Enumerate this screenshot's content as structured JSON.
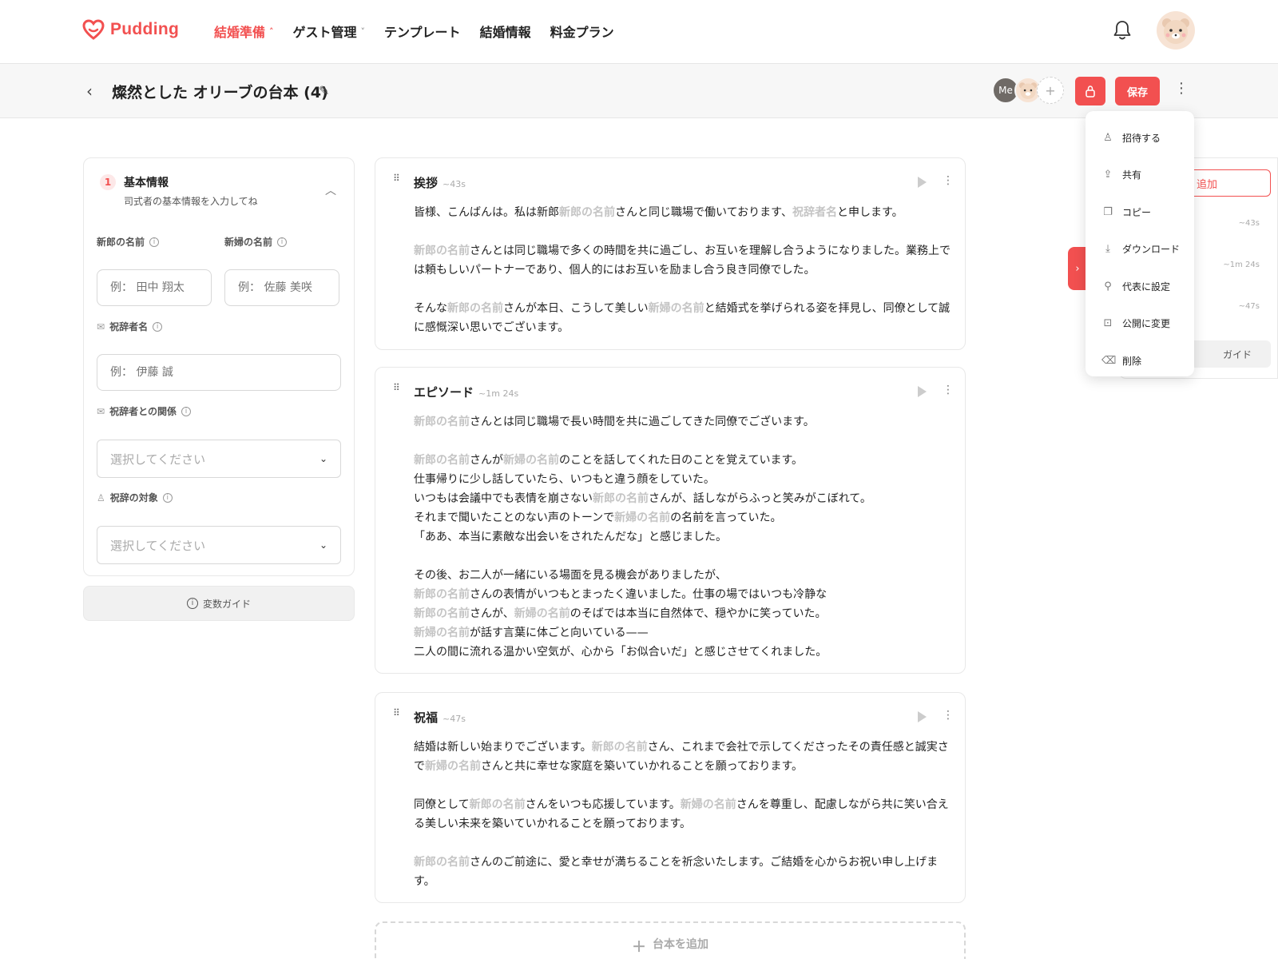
{
  "brand": {
    "name": "Pudding",
    "color": "#f25050"
  },
  "nav": {
    "items": [
      {
        "label": "結婚準備",
        "active": true,
        "chevron": "˄"
      },
      {
        "label": "ゲスト管理",
        "active": false,
        "chevron": "˅"
      },
      {
        "label": "テンプレート",
        "active": false,
        "chevron": ""
      },
      {
        "label": "結婚情報",
        "active": false,
        "chevron": ""
      },
      {
        "label": "料金プラン",
        "active": false,
        "chevron": ""
      }
    ]
  },
  "subheader": {
    "title": "燦然とした オリーブの台本 (4)",
    "collaborator_me": "Me",
    "save_label": "保存"
  },
  "basic_info": {
    "step": "1",
    "title": "基本情報",
    "subtitle": "司式者の基本情報を入力してね",
    "groom_label": "新郎の名前",
    "groom_placeholder": "例： 田中 翔太",
    "bride_label": "新婦の名前",
    "bride_placeholder": "例： 佐藤 美咲",
    "speaker_label": "祝辞者名",
    "speaker_placeholder": "例： 伊藤 誠",
    "relation_label": "祝辞者との関係",
    "relation_value": "選択してください",
    "target_label": "祝辞の対象",
    "target_value": "選択してください",
    "guide_label": "変数ガイド"
  },
  "scripts": [
    {
      "title": "挨拶",
      "duration": "~43s",
      "paragraphs": [
        [
          [
            "t",
            "皆様、こんばんは。私は新郎"
          ],
          [
            "v",
            "新郎の名前"
          ],
          [
            "t",
            "さんと同じ職場で働いております、"
          ],
          [
            "v",
            "祝辞者名"
          ],
          [
            "t",
            "と申します。"
          ]
        ],
        [
          [
            "v",
            "新郎の名前"
          ],
          [
            "t",
            "さんとは同じ職場で多くの時間を共に過ごし、お互いを理解し合うようになりました。業務上では頼もしいパートナーであり、個人的にはお互いを励まし合う良き同僚でした。"
          ]
        ],
        [
          [
            "t",
            "そんな"
          ],
          [
            "v",
            "新郎の名前"
          ],
          [
            "t",
            "さんが本日、こうして美しい"
          ],
          [
            "v",
            "新婦の名前"
          ],
          [
            "t",
            "と結婚式を挙げられる姿を拝見し、同僚として誠に感慨深い思いでございます。"
          ]
        ]
      ]
    },
    {
      "title": "エピソード",
      "duration": "~1m 24s",
      "paragraphs": [
        [
          [
            "v",
            "新郎の名前"
          ],
          [
            "t",
            "さんとは同じ職場で長い時間を共に過ごしてきた同僚でございます。"
          ]
        ],
        [
          [
            "v",
            "新郎の名前"
          ],
          [
            "t",
            "さんが"
          ],
          [
            "v",
            "新婦の名前"
          ],
          [
            "t",
            "のことを話してくれた日のことを覚えています。"
          ],
          [
            "br",
            ""
          ],
          [
            "t",
            "仕事帰りに少し話していたら、いつもと違う顔をしていた。"
          ],
          [
            "br",
            ""
          ],
          [
            "t",
            "いつもは会議中でも表情を崩さない"
          ],
          [
            "v",
            "新郎の名前"
          ],
          [
            "t",
            "さんが、話しながらふっと笑みがこぼれて。"
          ],
          [
            "br",
            ""
          ],
          [
            "t",
            "それまで聞いたことのない声のトーンで"
          ],
          [
            "v",
            "新婦の名前"
          ],
          [
            "t",
            "の名前を言っていた。"
          ],
          [
            "br",
            ""
          ],
          [
            "t",
            "「ああ、本当に素敵な出会いをされたんだな」と感じました。"
          ]
        ],
        [
          [
            "t",
            "その後、お二人が一緒にいる場面を見る機会がありましたが、"
          ],
          [
            "br",
            ""
          ],
          [
            "v",
            "新郎の名前"
          ],
          [
            "t",
            "さんの表情がいつもとまったく違いました。仕事の場ではいつも冷静な"
          ],
          [
            "br",
            ""
          ],
          [
            "v",
            "新郎の名前"
          ],
          [
            "t",
            "さんが、"
          ],
          [
            "v",
            "新婦の名前"
          ],
          [
            "t",
            "のそばでは本当に自然体で、穏やかに笑っていた。"
          ],
          [
            "br",
            ""
          ],
          [
            "v",
            "新婦の名前"
          ],
          [
            "t",
            "が話す言葉に体ごと向いている——"
          ],
          [
            "br",
            ""
          ],
          [
            "t",
            "二人の間に流れる温かい空気が、心から「お似合いだ」と感じさせてくれました。"
          ]
        ]
      ]
    },
    {
      "title": "祝福",
      "duration": "~47s",
      "paragraphs": [
        [
          [
            "t",
            "結婚は新しい始まりでございます。"
          ],
          [
            "v",
            "新郎の名前"
          ],
          [
            "t",
            "さん、これまで会社で示してくださったその責任感と誠実さで"
          ],
          [
            "v",
            "新婦の名前"
          ],
          [
            "t",
            "さんと共に幸せな家庭を築いていかれることを願っております。"
          ]
        ],
        [
          [
            "t",
            "同僚として"
          ],
          [
            "v",
            "新郎の名前"
          ],
          [
            "t",
            "さんをいつも応援しています。"
          ],
          [
            "v",
            "新婦の名前"
          ],
          [
            "t",
            "さんを尊重し、配慮しながら共に笑い合える美しい未来を築いていかれることを願っております。"
          ]
        ],
        [
          [
            "v",
            "新郎の名前"
          ],
          [
            "t",
            "さんのご前途に、愛と幸せが満ちることを祈念いたします。ご結婚を心からお祝い申し上げます。"
          ]
        ]
      ]
    }
  ],
  "add_script_label": "台本を追加",
  "right_panel": {
    "add_label": "追加",
    "durations": [
      "~43s",
      "~1m 24s",
      "~47s"
    ],
    "guide_label": "ガイド"
  },
  "menu": {
    "items": [
      {
        "label": "招待する",
        "icon": "user-plus-icon",
        "glyph": "♙"
      },
      {
        "label": "共有",
        "icon": "share-icon",
        "glyph": "⇪"
      },
      {
        "label": "コピー",
        "icon": "copy-icon",
        "glyph": "❐"
      },
      {
        "label": "ダウンロード",
        "icon": "download-icon",
        "glyph": "⤓"
      },
      {
        "label": "代表に設定",
        "icon": "pin-icon",
        "glyph": "⚲"
      },
      {
        "label": "公開に変更",
        "icon": "lock-icon",
        "glyph": "⊡"
      },
      {
        "label": "削除",
        "icon": "trash-icon",
        "glyph": "⌫"
      }
    ]
  }
}
